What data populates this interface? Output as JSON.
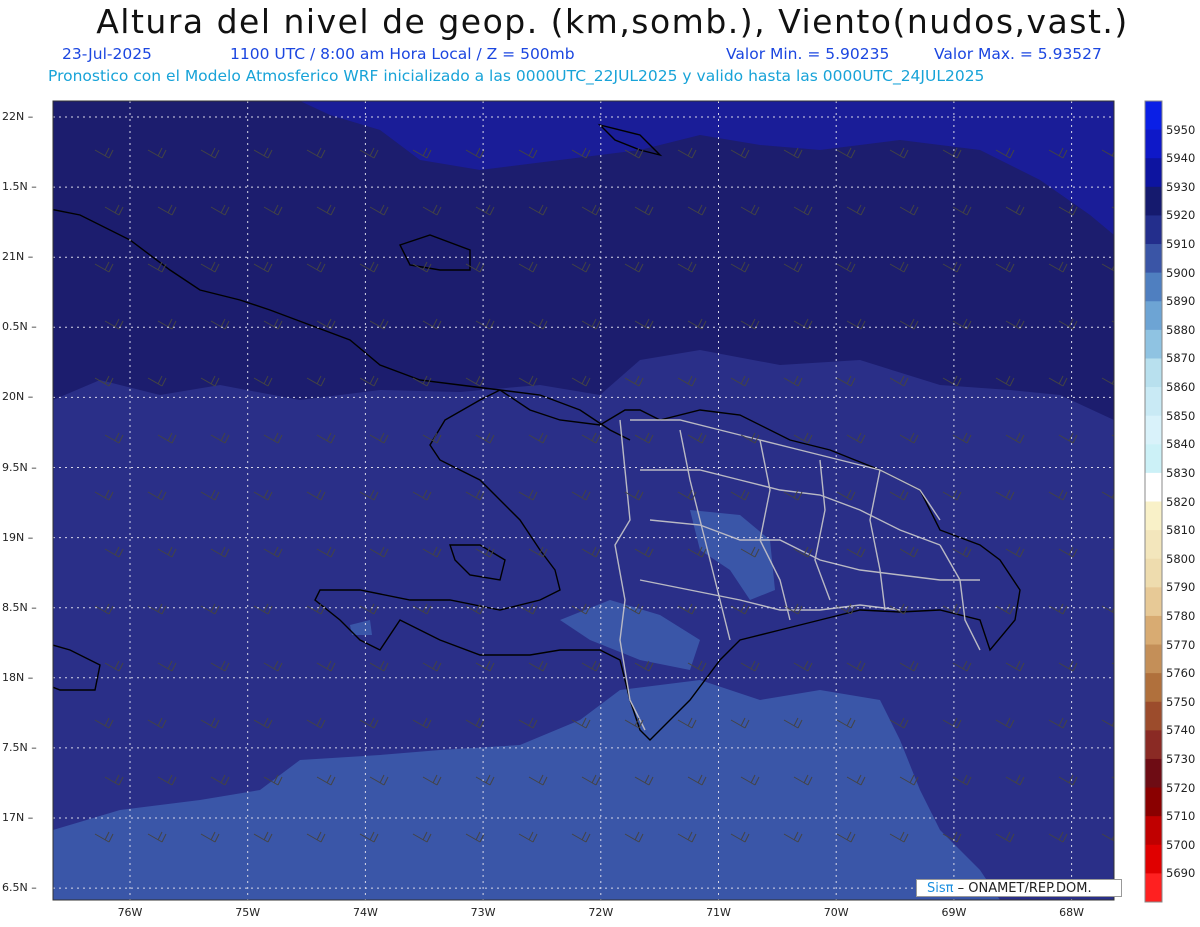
{
  "title": "Altura del nivel de geop. (km,somb.), Viento(nudos,vast.)",
  "date": "23-Jul-2025",
  "time_info": "1100 UTC / 8:00 am Hora Local / Z = 500mb",
  "min_value": "Valor Min. = 5.90235",
  "max_value": "Valor Max. = 5.93527",
  "model_info": "Pronostico con el Modelo Atmosferico WRF inicializado a las 0000UTC_22JUL2025 y valido hasta las  0000UTC_24JUL2025",
  "credit": {
    "brand": "Sisπ",
    "text": " – ONAMET/REP.DOM."
  },
  "lat_labels": [
    "22N",
    "1.5N",
    "21N",
    "0.5N",
    "20N",
    "9.5N",
    "19N",
    "8.5N",
    "18N",
    "7.5N",
    "17N",
    "6.5N"
  ],
  "lon_labels": [
    "76W",
    "75W",
    "74W",
    "73W",
    "72W",
    "71W",
    "70W",
    "69W",
    "68W"
  ],
  "colorbar": {
    "labels": [
      "5950",
      "5940",
      "5930",
      "5920",
      "5910",
      "5900",
      "5890",
      "5880",
      "5870",
      "5860",
      "5850",
      "5840",
      "5830",
      "5820",
      "5810",
      "5800",
      "5790",
      "5780",
      "5770",
      "5760",
      "5750",
      "5740",
      "5730",
      "5720",
      "5710",
      "5700",
      "5690"
    ],
    "colors": [
      "#0a1fe6",
      "#0e18c8",
      "#0d14a0",
      "#151a6e",
      "#232e8c",
      "#3a55a6",
      "#4f7fc0",
      "#6da4d4",
      "#8fc3e2",
      "#b8e0ee",
      "#c9eaf5",
      "#d9f2fa",
      "#ccf1f7",
      "#ffffff",
      "#f9f1c8",
      "#f3e6bc",
      "#eedcae",
      "#e7c996",
      "#d8ab72",
      "#c48f58",
      "#b0703c",
      "#9c4c2c",
      "#8a2a24",
      "#6e0c14",
      "#8a0000",
      "#c00000",
      "#e00000",
      "#ff2020"
    ]
  }
}
